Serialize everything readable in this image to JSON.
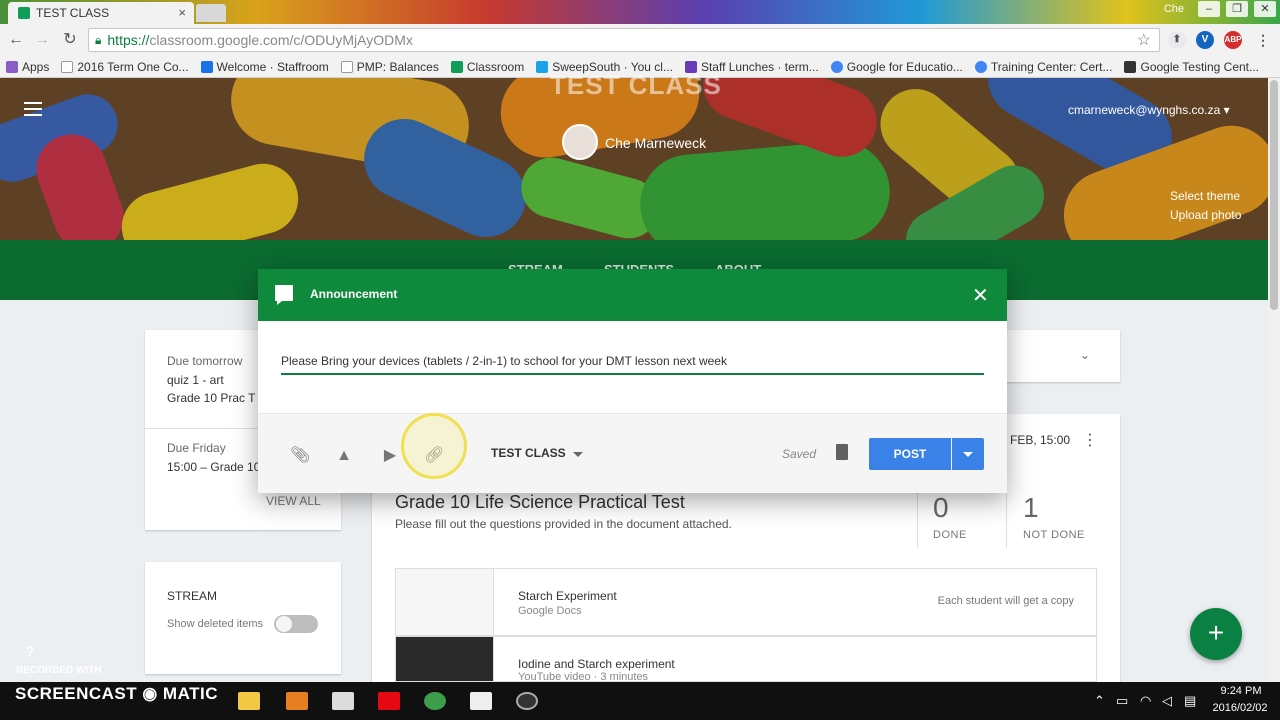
{
  "browser": {
    "tab_title": "TEST CLASS",
    "tab_close": "×",
    "window_user": "Che",
    "url_https": "https://",
    "url_rest": "classroom.google.com/c/ODUyMjAyODMx",
    "extensions": [
      "ABP"
    ],
    "bookmarks": [
      {
        "label": "Apps",
        "color": "#8a5cc8"
      },
      {
        "label": "2016 Term One Co...",
        "color": "#777777"
      },
      {
        "label": "Welcome · Staffroom",
        "color": "#1a73e8"
      },
      {
        "label": "PMP: Balances",
        "color": "#777777"
      },
      {
        "label": "Classroom",
        "color": "#0f9d58"
      },
      {
        "label": "SweepSouth · You cl...",
        "color": "#1aa3e8"
      },
      {
        "label": "Staff Lunches · term...",
        "color": "#673ab7"
      },
      {
        "label": "Google for Educatio...",
        "color": "#4285f4"
      },
      {
        "label": "Training Center: Cert...",
        "color": "#4285f4"
      },
      {
        "label": "Google Testing Cent...",
        "color": "#333333"
      }
    ]
  },
  "header": {
    "class_title": "TEST CLASS",
    "teacher": "Che Marneweck",
    "account": "cmarneweck@wynghs.co.za ▾",
    "select_theme": "Select theme",
    "upload_photo": "Upload photo",
    "tabs": [
      "STREAM",
      "STUDENTS",
      "ABOUT"
    ]
  },
  "upcoming": {
    "due1_label": "Due tomorrow",
    "due1_item1": "quiz 1 - art",
    "due1_item2": "Grade 10 Prac T",
    "due2_label": "Due Friday",
    "due2_item1": "15:00 – Grade 10",
    "view_all": "VIEW ALL"
  },
  "stream_filter": {
    "title": "STREAM",
    "show_deleted": "Show deleted items"
  },
  "post": {
    "due": "FEB, 15:00",
    "title": "Grade 10 Life Science Practical Test",
    "description": "Please fill out the questions provided in the document attached.",
    "done_count": "0",
    "done_label": "DONE",
    "not_done_count": "1",
    "not_done_label": "NOT DONE",
    "attachments": [
      {
        "title": "Starch Experiment",
        "type": "Google Docs",
        "note": "Each student will get a copy"
      },
      {
        "title": "Iodine and Starch experiment",
        "type": "YouTube video · 3 minutes",
        "note": ""
      }
    ]
  },
  "dialog": {
    "title": "Announcement",
    "text": "Please Bring your devices (tablets / 2-in-1) to school for your DMT lesson next week",
    "class_select": "TEST CLASS",
    "saved": "Saved",
    "post_label": "POST"
  },
  "screencast": {
    "help": "?",
    "recorded": "RECORDED WITH",
    "brand": "SCREENCAST ◉ MATIC"
  },
  "taskbar": {
    "time": "9:24 PM",
    "date": "2016/02/02"
  },
  "colors": {
    "header_green": "#0f8a3c",
    "nav_green": "#0b6b30",
    "post_blue": "#3b82e8"
  }
}
